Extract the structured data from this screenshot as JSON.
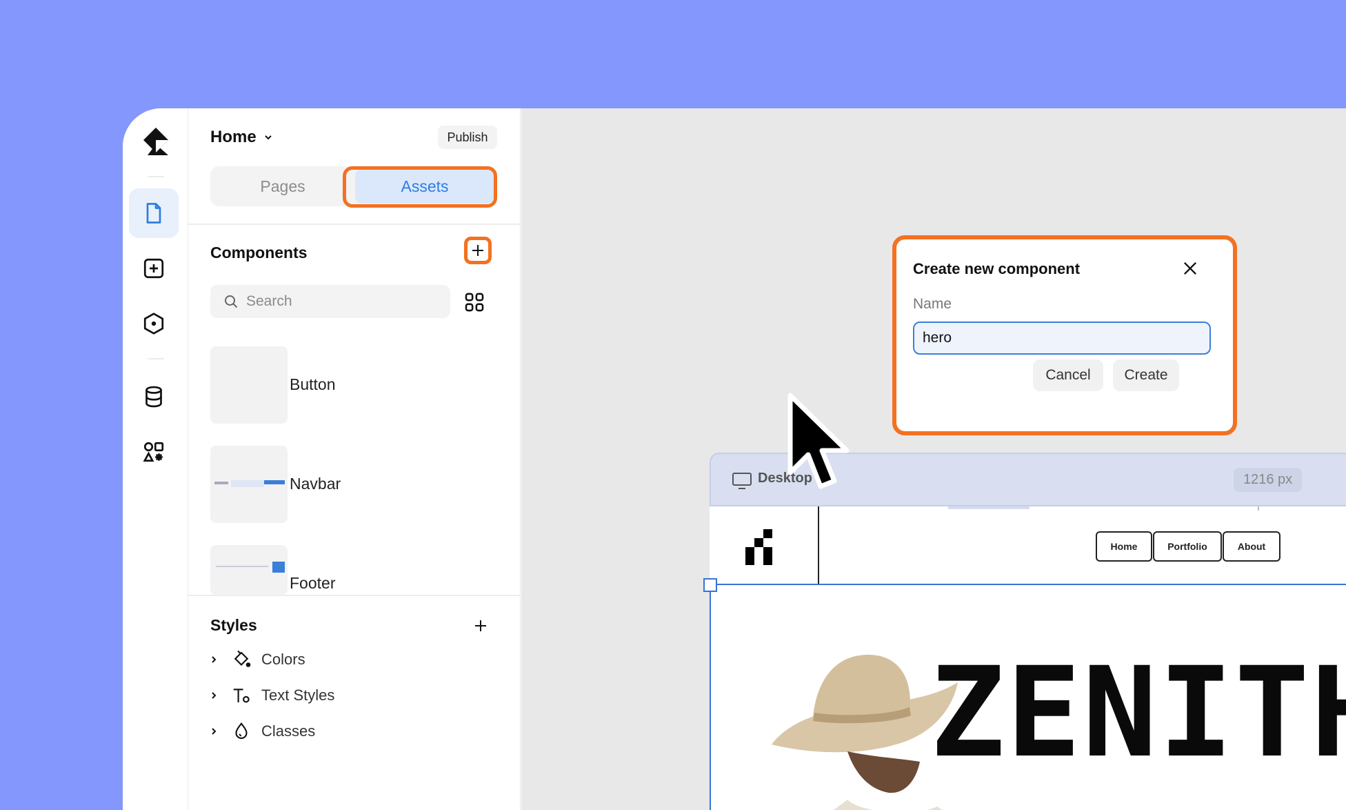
{
  "header": {
    "page_name": "Home",
    "publish_label": "Publish"
  },
  "tabs": {
    "pages_label": "Pages",
    "assets_label": "Assets"
  },
  "components": {
    "title": "Components",
    "search_placeholder": "Search",
    "items": [
      {
        "label": "Button"
      },
      {
        "label": "Navbar"
      },
      {
        "label": "Footer"
      }
    ]
  },
  "styles": {
    "title": "Styles",
    "items": [
      {
        "label": "Colors",
        "icon": "paint-bucket-icon"
      },
      {
        "label": "Text Styles",
        "icon": "text-style-icon"
      },
      {
        "label": "Classes",
        "icon": "drop-icon"
      }
    ]
  },
  "dialog": {
    "title": "Create new component",
    "name_label": "Name",
    "name_value": "hero",
    "cancel_label": "Cancel",
    "create_label": "Create"
  },
  "frame": {
    "name": "Desktop",
    "size": "1216 px",
    "nav_links": [
      "Home",
      "Portfolio",
      "About"
    ],
    "hero_text": "ZENITH"
  },
  "colors": {
    "background": "#8497fd",
    "highlight": "#f37121",
    "accent": "#2f7de1"
  }
}
